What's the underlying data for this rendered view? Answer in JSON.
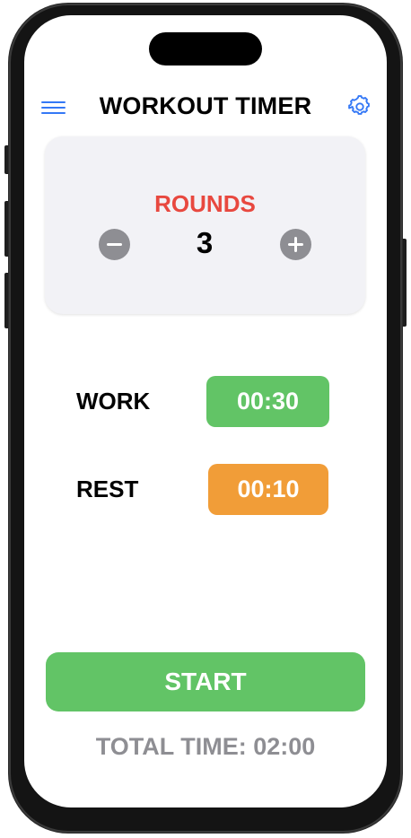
{
  "header": {
    "title": "WORKOUT TIMER",
    "menu_icon": "hamburger-menu-icon",
    "settings_icon": "gear-icon"
  },
  "rounds": {
    "label": "ROUNDS",
    "value": "3",
    "decrement_icon": "minus-circle-icon",
    "increment_icon": "plus-circle-icon"
  },
  "work": {
    "label": "WORK",
    "time": "00:30"
  },
  "rest": {
    "label": "REST",
    "time": "00:10"
  },
  "start": {
    "label": "START"
  },
  "total": {
    "text": "TOTAL TIME: 02:00"
  },
  "colors": {
    "accent_blue": "#3478f6",
    "rounds_red": "#e8483f",
    "work_green": "#62c466",
    "rest_orange": "#f19d38",
    "muted_gray": "#8e8e93",
    "card_bg": "#f2f2f6"
  }
}
